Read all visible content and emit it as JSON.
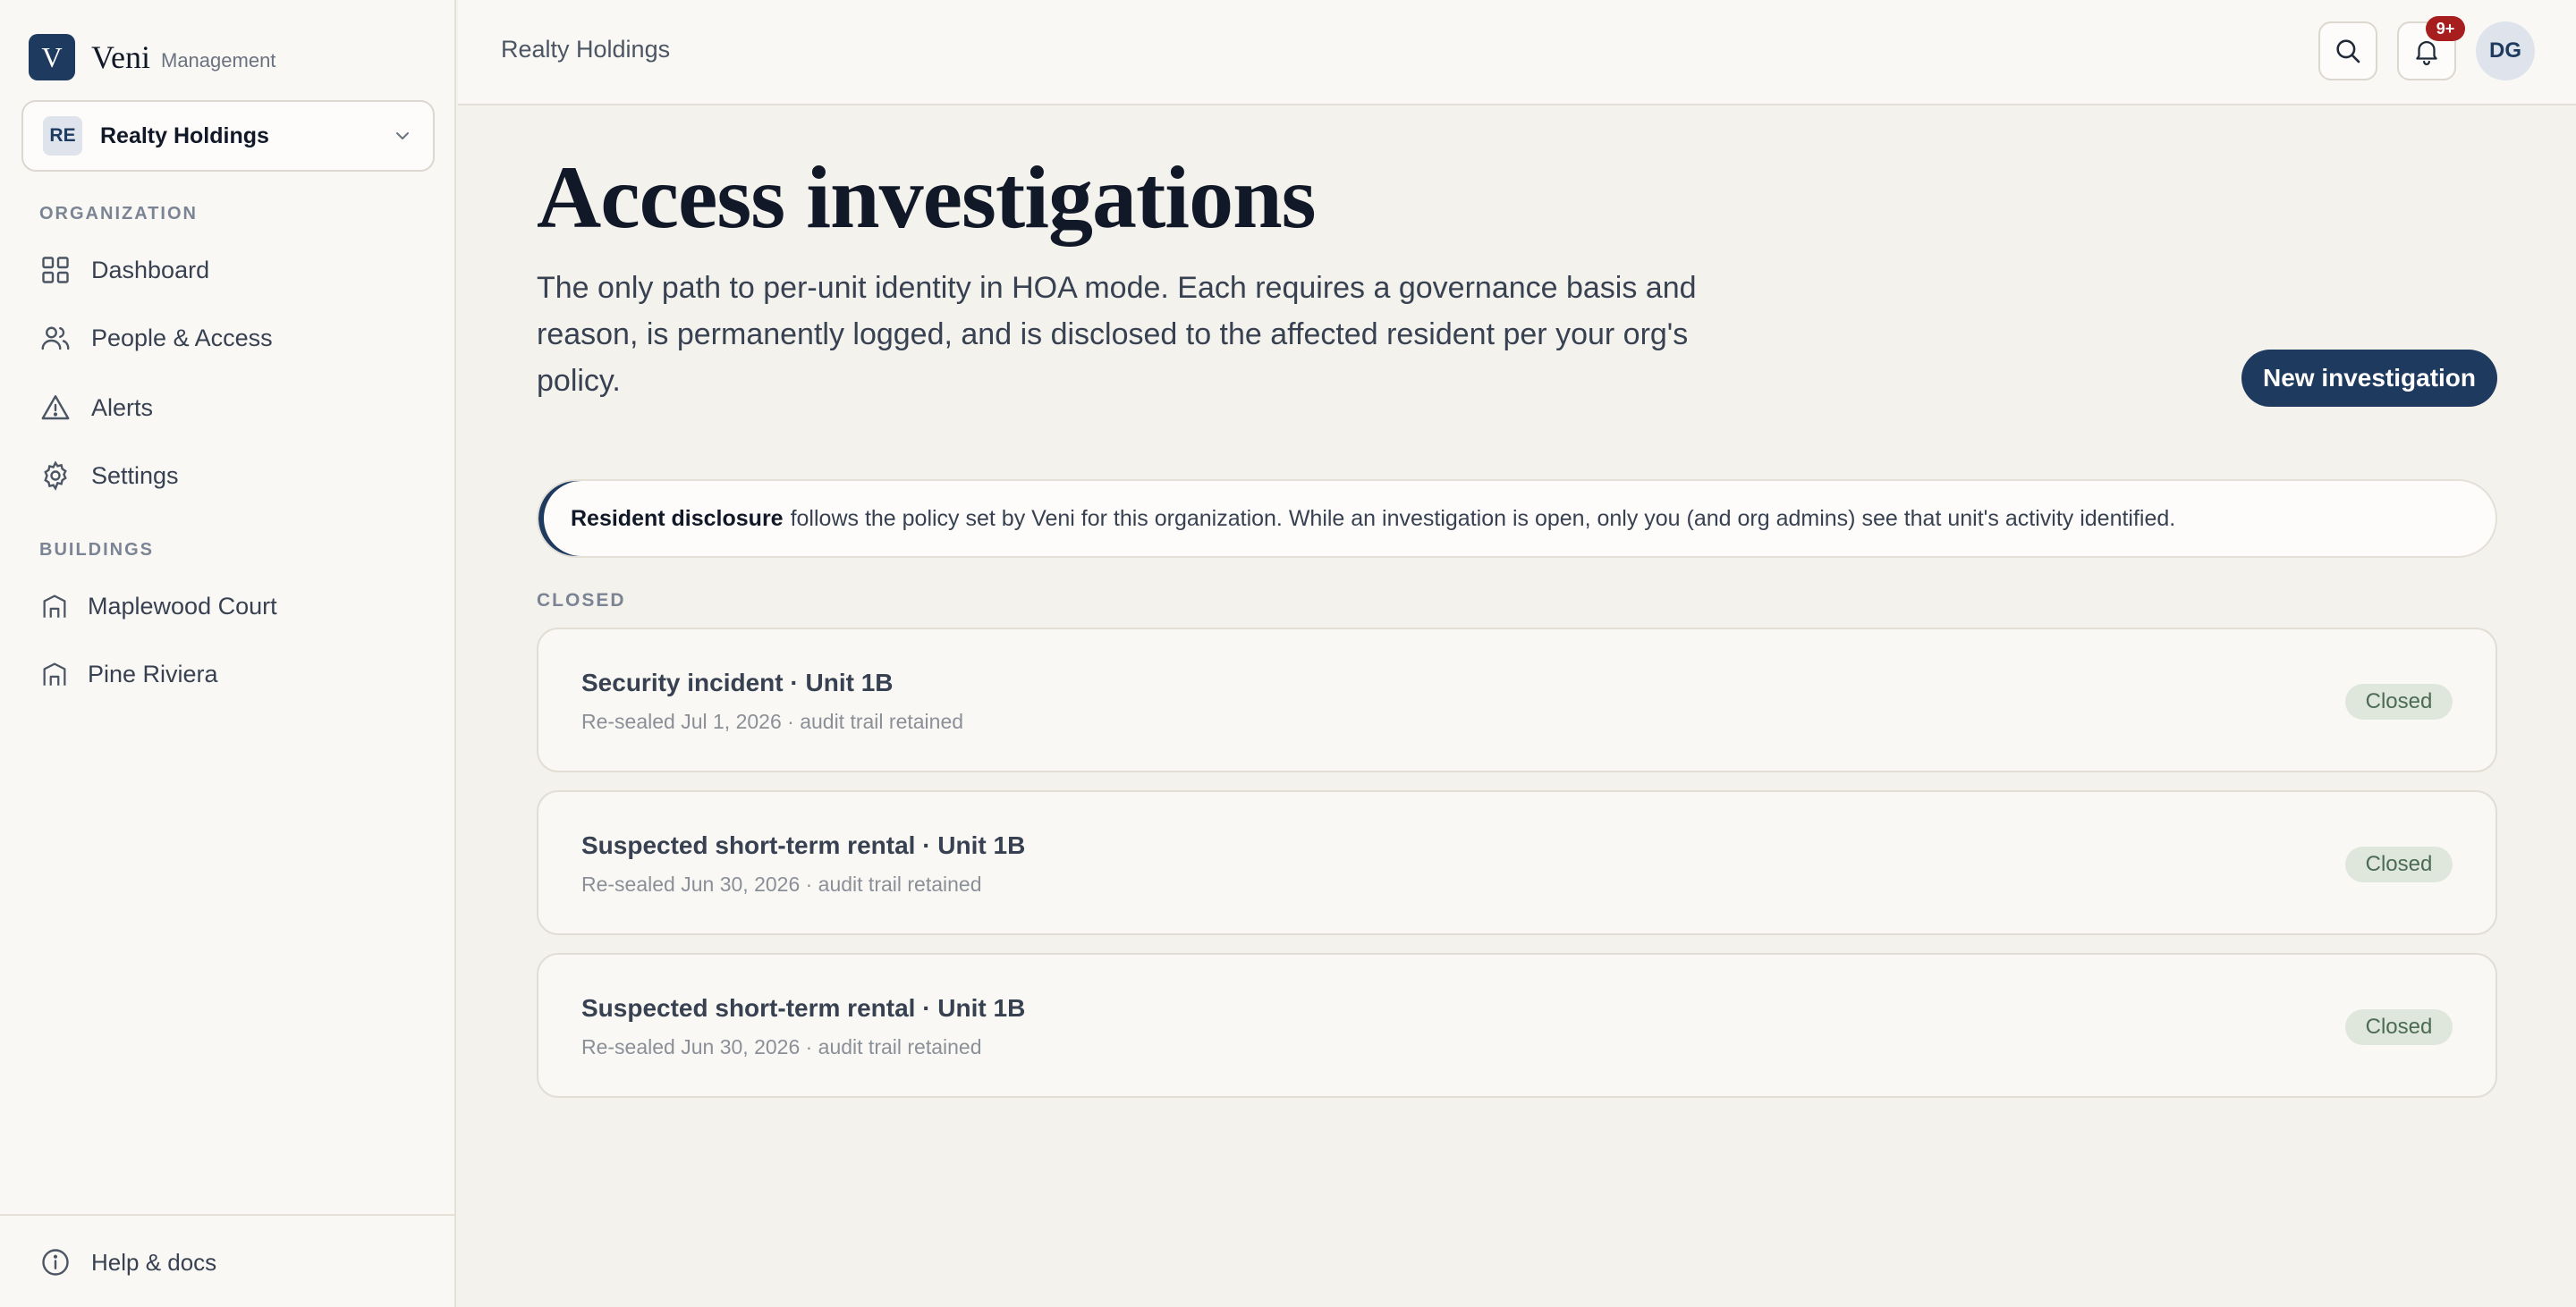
{
  "brand": {
    "logo_letter": "V",
    "name": "Veni",
    "subtitle": "Management"
  },
  "org_switcher": {
    "initials": "RE",
    "name": "Realty Holdings",
    "icon": "chevron-down-icon"
  },
  "sidebar": {
    "organization_label": "ORGANIZATION",
    "items": [
      {
        "label": "Dashboard",
        "icon": "grid-icon"
      },
      {
        "label": "People & Access",
        "icon": "users-icon"
      },
      {
        "label": "Alerts",
        "icon": "warning-icon"
      },
      {
        "label": "Settings",
        "icon": "gear-icon"
      }
    ],
    "buildings_label": "BUILDINGS",
    "buildings": [
      {
        "label": "Maplewood Court",
        "icon": "building-icon"
      },
      {
        "label": "Pine Riviera",
        "icon": "building-icon"
      }
    ],
    "help": {
      "label": "Help & docs",
      "icon": "info-icon"
    }
  },
  "topbar": {
    "breadcrumb": "Realty Holdings",
    "notification_badge": "9+",
    "user_initials": "DG"
  },
  "main": {
    "title": "Access investigations",
    "description": "The only path to per‑unit identity in HOA mode. Each requires a governance basis and reason, is permanently logged, and is disclosed to the affected resident per your org's policy.",
    "new_button": "New investigation",
    "callout": {
      "bold": "Resident disclosure",
      "text": "follows the policy set by Veni for this organization. While an investigation is open, only you (and org admins) see that unit's activity identified."
    },
    "section_label": "CLOSED",
    "investigations": [
      {
        "title": "Security incident · Unit 1B",
        "subtitle": "Re‑sealed Jul 1, 2026 · audit trail retained",
        "status": "Closed"
      },
      {
        "title": "Suspected short‑term rental · Unit 1B",
        "subtitle": "Re‑sealed Jun 30, 2026 · audit trail retained",
        "status": "Closed"
      },
      {
        "title": "Suspected short‑term rental · Unit 1B",
        "subtitle": "Re‑sealed Jun 30, 2026 · audit trail retained",
        "status": "Closed"
      }
    ]
  },
  "colors": {
    "accent": "#1e3a5f",
    "badge_red": "#a61e1e",
    "status_closed_bg": "#dfe6dc",
    "status_closed_text": "#4b6b53"
  }
}
